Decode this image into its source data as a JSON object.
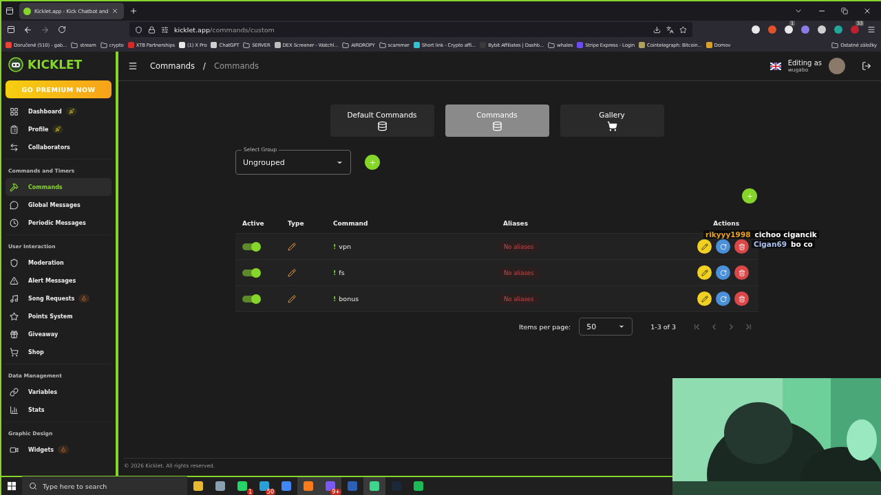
{
  "browser": {
    "tabs": [
      {
        "title": "Kicklet.app - Kick Chatbot and",
        "selected": true
      }
    ],
    "url": {
      "host": "kicklet.app",
      "path": "/commands/custom"
    },
    "extensions": [
      {
        "color": "#e8e8e8"
      },
      {
        "color": "#e0522a"
      },
      {
        "color": "#e8e8e8",
        "badge": "1"
      },
      {
        "color": "#8a7ce8"
      },
      {
        "color": "#cfcfcf"
      },
      {
        "color": "#1fa89a"
      },
      {
        "color": "#c02030",
        "badge": "33"
      }
    ],
    "bookmarks": [
      {
        "label": "Doručené (510) - gab...",
        "kind": "site",
        "color": "#ea4335"
      },
      {
        "label": "stream",
        "kind": "folder"
      },
      {
        "label": "crypto",
        "kind": "folder"
      },
      {
        "label": "XTB Partnerships",
        "kind": "site",
        "color": "#d62a2a"
      },
      {
        "label": "(1) X Pro",
        "kind": "site",
        "color": "#e8e8e8"
      },
      {
        "label": "ChatGPT",
        "kind": "site",
        "color": "#cfcfcf"
      },
      {
        "label": "SERVER",
        "kind": "folder"
      },
      {
        "label": "DEX Screener - Watchl...",
        "kind": "site",
        "color": "#bdbdbd"
      },
      {
        "label": "AIRDROPY",
        "kind": "folder"
      },
      {
        "label": "scammer",
        "kind": "folder"
      },
      {
        "label": "Short link - Crypto affi...",
        "kind": "site",
        "color": "#2ec4d6"
      },
      {
        "label": "Bybit Affiliates | Dashb...",
        "kind": "site",
        "color": "#3a3a3a"
      },
      {
        "label": "whales",
        "kind": "folder"
      },
      {
        "label": "Stripe Express - Login",
        "kind": "site",
        "color": "#6a4cf0"
      },
      {
        "label": "Cointelegraph: Bitcoin...",
        "kind": "site",
        "color": "#b0a060"
      },
      {
        "label": "Domov",
        "kind": "site",
        "color": "#d9a030"
      }
    ],
    "other_bookmarks": "Ostatné záložky"
  },
  "sidebar": {
    "logo": "KICKLET",
    "premium_button": "GO PREMIUM NOW",
    "sections": [
      {
        "items": [
          {
            "label": "Dashboard",
            "kind": "rocket_badge",
            "selected": false
          },
          {
            "label": "Profile",
            "kind": "rocket_badge",
            "selected": false
          },
          {
            "label": "Collaborators",
            "kind": "plain",
            "selected": false
          }
        ]
      },
      {
        "heading": "Commands and Timers",
        "items": [
          {
            "label": "Commands",
            "kind": "plain",
            "selected": true
          },
          {
            "label": "Global Messages",
            "kind": "plain",
            "selected": false
          },
          {
            "label": "Periodic Messages",
            "kind": "plain",
            "selected": false
          }
        ]
      },
      {
        "heading": "User Interaction",
        "items": [
          {
            "label": "Moderation",
            "kind": "plain",
            "selected": false
          },
          {
            "label": "Alert Messages",
            "kind": "plain",
            "selected": false
          },
          {
            "label": "Song Requests",
            "kind": "fire_badge",
            "selected": false
          },
          {
            "label": "Points System",
            "kind": "plain",
            "selected": false
          },
          {
            "label": "Giveaway",
            "kind": "plain",
            "selected": false
          },
          {
            "label": "Shop",
            "kind": "plain",
            "selected": false
          }
        ]
      },
      {
        "heading": "Data Management",
        "items": [
          {
            "label": "Variables",
            "kind": "plain",
            "selected": false
          },
          {
            "label": "Stats",
            "kind": "plain",
            "selected": false
          }
        ]
      },
      {
        "heading": "Graphic Design",
        "items": [
          {
            "label": "Widgets",
            "kind": "fire_badge",
            "selected": false
          }
        ]
      }
    ]
  },
  "header": {
    "breadcrumb": [
      "Commands",
      "Commands"
    ],
    "separator": "/",
    "editing_label": "Editing as",
    "user": "wugabo"
  },
  "tabs": [
    {
      "label": "Default Commands",
      "selected": false
    },
    {
      "label": "Commands",
      "selected": true
    },
    {
      "label": "Gallery",
      "selected": false
    }
  ],
  "group_select": {
    "label": "Select Group",
    "value": "Ungrouped"
  },
  "table": {
    "columns": [
      "Active",
      "Type",
      "Command",
      "Aliases",
      "Actions"
    ],
    "rows": [
      {
        "active": true,
        "prefix": "!",
        "command": "vpn",
        "aliases": "No aliases"
      },
      {
        "active": true,
        "prefix": "!",
        "command": "fs",
        "aliases": "No aliases"
      },
      {
        "active": true,
        "prefix": "!",
        "command": "bonus",
        "aliases": "No aliases"
      }
    ]
  },
  "pagination": {
    "label": "Items per page:",
    "value": "50",
    "range": "1-3 of 3"
  },
  "footer": "© 2026 Kicklet. All rights reserved.",
  "stream_chat": [
    {
      "user": "rikyyy1998",
      "message": "cichoo cigancik",
      "color": "#e8a020"
    },
    {
      "user": "Cigan69",
      "message": "bo co",
      "color": "#a8c0f0"
    }
  ],
  "taskbar": {
    "search_placeholder": "Type here to search",
    "apps": [
      {
        "color": "#e8b830",
        "selected": false
      },
      {
        "color": "#8aa0b0",
        "selected": false
      },
      {
        "color": "#25d366",
        "badge": "1",
        "selected": false
      },
      {
        "color": "#2aa0d8",
        "badge": "50",
        "selected": false
      },
      {
        "color": "#4285f4",
        "selected": false
      },
      {
        "color": "#ff7a1a",
        "selected": true
      },
      {
        "color": "#7a5af0",
        "badge": "9+",
        "selected": true
      },
      {
        "color": "#2b5fb8",
        "selected": false
      },
      {
        "color": "#3dd68c",
        "selected": true
      },
      {
        "color": "#1b2838",
        "selected": false
      },
      {
        "color": "#1db954",
        "selected": false
      }
    ]
  }
}
